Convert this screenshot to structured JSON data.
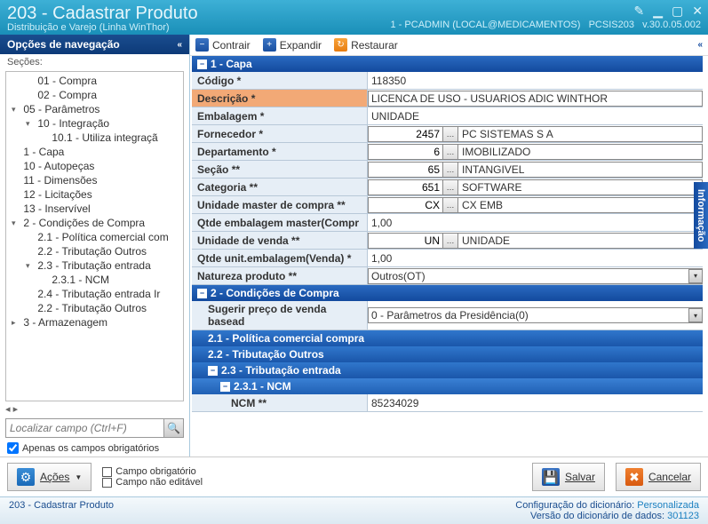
{
  "titlebar": {
    "title": "203 - Cadastrar  Produto",
    "subtitle": "Distribuição e Varejo (Linha WinThor)",
    "session": "1 - PCADMIN (LOCAL@MEDICAMENTOS)",
    "program": "PCSIS203",
    "version": "v.30.0.05.002"
  },
  "sidebar": {
    "header": "Opções de navegação",
    "sections_label": "Seções:",
    "tree": [
      {
        "indent": 1,
        "tw": "",
        "label": "01 - Compra"
      },
      {
        "indent": 1,
        "tw": "",
        "label": "02 - Compra"
      },
      {
        "indent": 0,
        "tw": "▾",
        "label": "05 - Parâmetros"
      },
      {
        "indent": 1,
        "tw": "▾",
        "label": "10 - Integração"
      },
      {
        "indent": 2,
        "tw": "",
        "label": "10.1 - Utiliza integraçã"
      },
      {
        "indent": 0,
        "tw": "",
        "label": "1 - Capa"
      },
      {
        "indent": 0,
        "tw": "",
        "label": "10 - Autopeças"
      },
      {
        "indent": 0,
        "tw": "",
        "label": "11 - Dimensões"
      },
      {
        "indent": 0,
        "tw": "",
        "label": "12 - Licitações"
      },
      {
        "indent": 0,
        "tw": "",
        "label": "13 - Inservível"
      },
      {
        "indent": 0,
        "tw": "▾",
        "label": "2 - Condições de Compra"
      },
      {
        "indent": 1,
        "tw": "",
        "label": "2.1 - Política comercial com"
      },
      {
        "indent": 1,
        "tw": "",
        "label": "2.2 - Tributação Outros"
      },
      {
        "indent": 1,
        "tw": "▾",
        "label": "2.3 - Tributação entrada"
      },
      {
        "indent": 2,
        "tw": "",
        "label": "2.3.1 - NCM"
      },
      {
        "indent": 1,
        "tw": "",
        "label": "2.4 - Tributação entrada Ir"
      },
      {
        "indent": 1,
        "tw": "",
        "label": "2.2 - Tributação Outros"
      },
      {
        "indent": 0,
        "tw": "▸",
        "label": "3 - Armazenagem"
      }
    ],
    "search_placeholder": "Localizar campo (Ctrl+F)",
    "only_required": "Apenas os campos obrigatórios"
  },
  "toolbar": {
    "contrair": "Contrair",
    "expandir": "Expandir",
    "restaurar": "Restaurar"
  },
  "sec1_title": "1 - Capa",
  "fields": {
    "codigo": {
      "label": "Código *",
      "value": "118350"
    },
    "descricao": {
      "label": "Descrição *",
      "value": "LICENCA DE USO - USUARIOS ADIC WINTHOR"
    },
    "embalagem": {
      "label": "Embalagem *",
      "value": "UNIDADE"
    },
    "fornecedor": {
      "label": "Fornecedor *",
      "num": "2457",
      "desc": "PC SISTEMAS S A"
    },
    "departamento": {
      "label": "Departamento *",
      "num": "6",
      "desc": "IMOBILIZADO"
    },
    "secao": {
      "label": "Seção **",
      "num": "65",
      "desc": "INTANGIVEL"
    },
    "categoria": {
      "label": "Categoria **",
      "num": "651",
      "desc": "SOFTWARE"
    },
    "unid_master": {
      "label": "Unidade master de compra **",
      "num": "CX",
      "desc": "CX EMB"
    },
    "qtde_emb_master": {
      "label": "Qtde embalagem master(Compr",
      "value": "1,00"
    },
    "unid_venda": {
      "label": "Unidade de venda **",
      "num": "UN",
      "desc": "UNIDADE"
    },
    "qtde_unit_venda": {
      "label": "Qtde unit.embalagem(Venda) *",
      "value": "1,00"
    },
    "natureza": {
      "label": "Natureza produto **",
      "value": "Outros(OT)"
    }
  },
  "sec2_title": "2 - Condições de Compra",
  "sugerir": {
    "label": "Sugerir preço de venda basead",
    "value": "0 - Parâmetros da Presidência(0)"
  },
  "sub_21": "2.1 - Política comercial compra",
  "sub_22": "2.2 - Tributação Outros",
  "sub_23": "2.3 - Tributação entrada",
  "sub_231": "2.3.1 - NCM",
  "ncm": {
    "label": "NCM **",
    "value": "85234029"
  },
  "info_tab": "Informação",
  "buttons": {
    "acoes": "Ações",
    "salvar": "Salvar",
    "cancelar": "Cancelar"
  },
  "legend": {
    "req": "Campo obrigatório",
    "ro": "Campo não editável"
  },
  "status": {
    "left": "203 - Cadastrar  Produto",
    "cfg_lbl": "Configuração do dicionário:",
    "cfg_val": "Personalizada",
    "ver_lbl": "Versão do dicionário de dados:",
    "ver_val": "301123"
  }
}
